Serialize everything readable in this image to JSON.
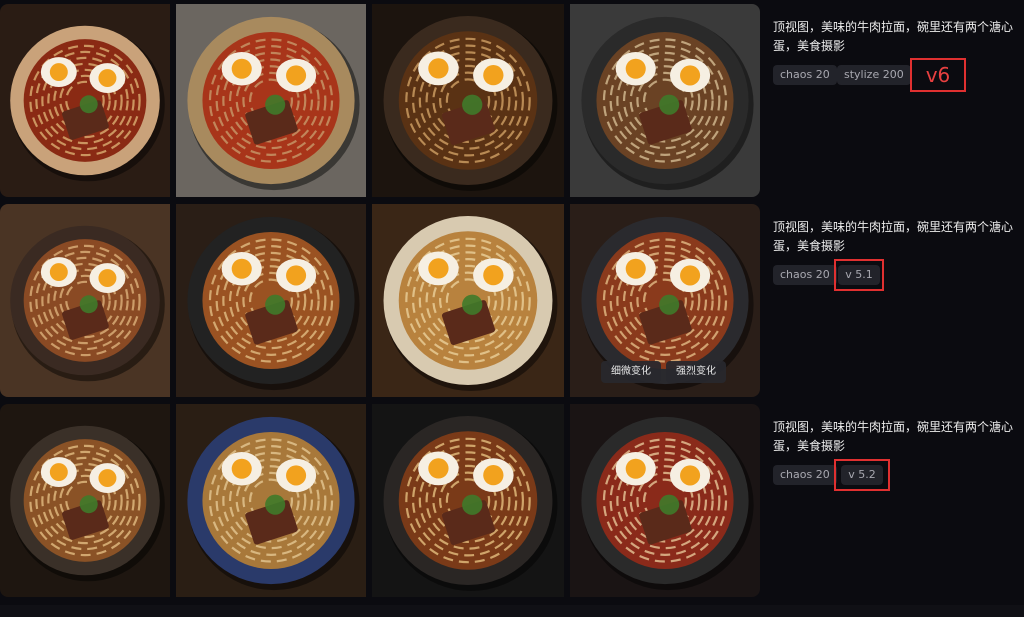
{
  "rows": [
    {
      "prompt": "顶视图，美味的牛肉拉面，碗里还有两个溏心蛋，美食摄影",
      "tags": [
        "chaos 20",
        "stylize 200"
      ],
      "version": "v6",
      "images": [
        {
          "alt": "ramen image 1",
          "bg": "#2a1c14",
          "bowl": "#c9a27a",
          "broth": "#8a2a14",
          "noodle": "#e0b878"
        },
        {
          "alt": "ramen image 2",
          "bg": "#6b6660",
          "bowl": "#a88a5e",
          "broth": "#a8351a",
          "noodle": "#caa070"
        },
        {
          "alt": "ramen image 3",
          "bg": "#1c140e",
          "bowl": "#3a2a1e",
          "broth": "#5a3214",
          "noodle": "#d8a86a"
        },
        {
          "alt": "ramen image 4",
          "bg": "#3a3a3a",
          "bowl": "#2a2a2a",
          "broth": "#6a4224",
          "noodle": "#dcc49a"
        }
      ]
    },
    {
      "prompt": "顶视图，美味的牛肉拉面，碗里还有两个溏心蛋，美食摄影",
      "tags": [
        "chaos 20"
      ],
      "version": "v 5.1",
      "images": [
        {
          "alt": "ramen image 5",
          "bg": "#4a3424",
          "bowl": "#3a2a22",
          "broth": "#8a4a24",
          "noodle": "#e2b880"
        },
        {
          "alt": "ramen image 6",
          "bg": "#2a1e16",
          "bowl": "#222",
          "broth": "#9a5222",
          "noodle": "#e6c48a"
        },
        {
          "alt": "ramen image 7",
          "bg": "#3a2616",
          "bowl": "#d8cab0",
          "broth": "#b8823e",
          "noodle": "#eed4a0"
        },
        {
          "alt": "ramen image 8",
          "bg": "#2a1e18",
          "bowl": "#2a2a2e",
          "broth": "#8a3a1c",
          "noodle": "#e8c48c"
        }
      ],
      "variation_buttons": [
        "细微变化",
        "强烈变化"
      ]
    },
    {
      "prompt": "顶视图，美味的牛肉拉面，碗里还有两个溏心蛋，美食摄影",
      "tags": [
        "chaos 20"
      ],
      "version": "v 5.2",
      "images": [
        {
          "alt": "ramen image 9",
          "bg": "#1e1610",
          "bowl": "#3a3028",
          "broth": "#8a5226",
          "noodle": "#e8c488"
        },
        {
          "alt": "ramen image 10",
          "bg": "#2a1e14",
          "bowl": "#2a3a6a",
          "broth": "#a8783a",
          "noodle": "#e8cc98"
        },
        {
          "alt": "ramen image 11",
          "bg": "#141414",
          "bowl": "#2a2624",
          "broth": "#7a3a18",
          "noodle": "#ecc886"
        },
        {
          "alt": "ramen image 12",
          "bg": "#1a1414",
          "bowl": "#2a2a2a",
          "broth": "#8a2a1a",
          "noodle": "#ecd0a0"
        }
      ]
    }
  ]
}
